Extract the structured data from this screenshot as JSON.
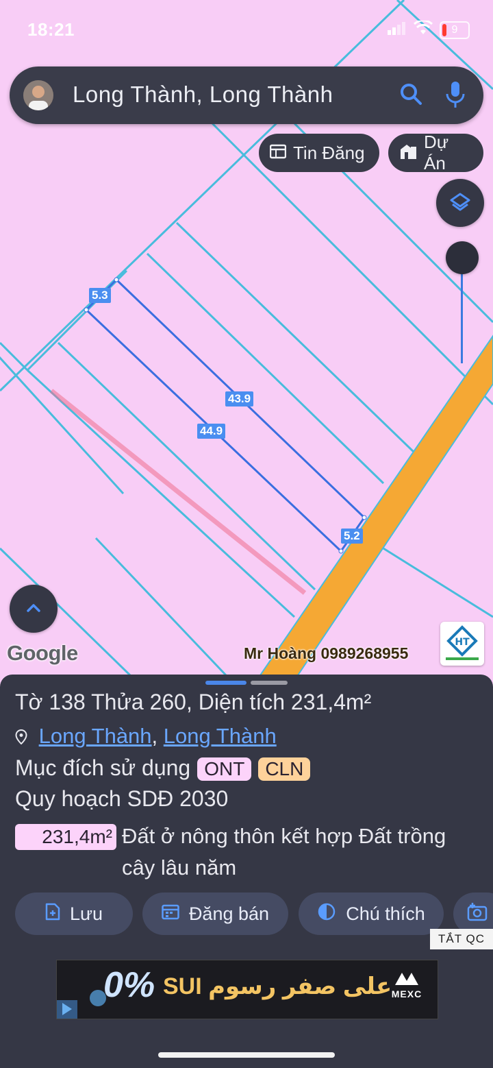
{
  "status_bar": {
    "time": "18:21",
    "battery": "9"
  },
  "search": {
    "query": "Long Thành, Long Thành"
  },
  "chips": {
    "listings": "Tin Đăng",
    "projects": "Dự Án"
  },
  "map": {
    "measurements": {
      "top_width": "5.3",
      "side_right": "43.9",
      "side_left": "44.9",
      "bottom_width": "5.2"
    },
    "google_label": "Google",
    "watermark": "Mr Hoàng 0989268955",
    "colors": {
      "land": "#f8cdf6",
      "parcel_line": "#40b8d8",
      "selected_line": "#3a6ee0",
      "road": "#f5a623"
    }
  },
  "parcel": {
    "title_prefix": "Tờ ",
    "sheet_no": "138",
    "title_mid": " Thửa ",
    "plot_no": "260",
    "title_area_label": ", Diện tích ",
    "area": "231,4m²",
    "location_part1": "Long Thành",
    "location_sep": ", ",
    "location_part2": "Long Thành",
    "usage_label": "Mục đích sử dụng",
    "usage_tags": [
      "ONT",
      "CLN"
    ],
    "plan_label": "Quy hoạch SDĐ 2030",
    "plan_area": "231,4m²",
    "plan_desc_line1": "Đất ở nông thôn kết hợp Đất trồng",
    "plan_desc_line2": "cây lâu năm"
  },
  "actions": {
    "save": "Lưu",
    "post_sale": "Đăng bán",
    "legend": "Chú thích"
  },
  "ads": {
    "hide_label": "TẮT QC",
    "banner_text": "SUI على صفر رسوم",
    "banner_brand": "MEXC",
    "banner_big": "0%"
  }
}
